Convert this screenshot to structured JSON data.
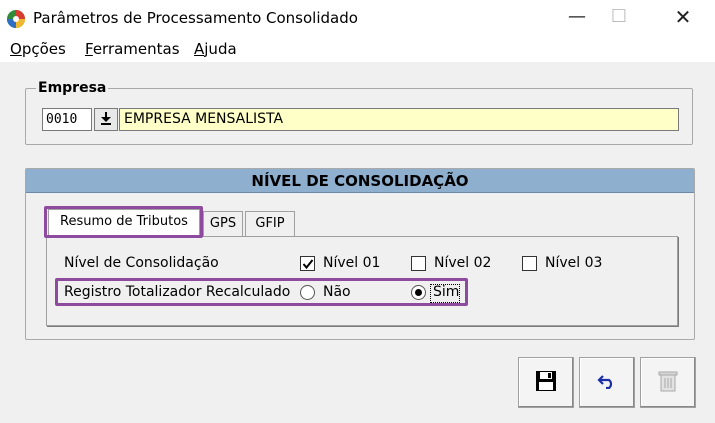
{
  "window": {
    "title": "Parâmetros de Processamento Consolidado",
    "minimize": "—",
    "maximize": "☐",
    "close": "✕"
  },
  "menu": [
    {
      "label": "Opções",
      "accel": "O",
      "rest": "pções"
    },
    {
      "label": "Ferramentas",
      "accel": "F",
      "rest": "erramentas"
    },
    {
      "label": "Ajuda",
      "accel": "A",
      "rest": "juda"
    }
  ],
  "empresa": {
    "group_label": "Empresa",
    "code": "0010",
    "name": "EMPRESA MENSALISTA"
  },
  "nivel": {
    "header": "NÍVEL DE CONSOLIDAÇÃO",
    "tabs": [
      {
        "label": "Resumo de Tributos",
        "active": true
      },
      {
        "label": "GPS",
        "active": false
      },
      {
        "label": "GFIP",
        "active": false
      }
    ],
    "level_label": "Nível de Consolidação",
    "levels": [
      {
        "label": "Nível 01",
        "checked": true
      },
      {
        "label": "Nível 02",
        "checked": false
      },
      {
        "label": "Nível 03",
        "checked": false
      }
    ],
    "recalc_label": "Registro Totalizador Recalculado",
    "recalc_options": [
      {
        "label": "Não",
        "selected": false
      },
      {
        "label": "Sim",
        "selected": true
      }
    ]
  },
  "colors": {
    "header_bg": "#8fafcf",
    "highlight": "#8e4a9e",
    "name_field_bg": "#ffffc8"
  },
  "icons": {
    "app": "app-logo-icon",
    "lookup": "download-arrow-icon",
    "save": "floppy-disk-icon",
    "undo": "undo-arrow-icon",
    "delete": "trash-can-icon"
  }
}
